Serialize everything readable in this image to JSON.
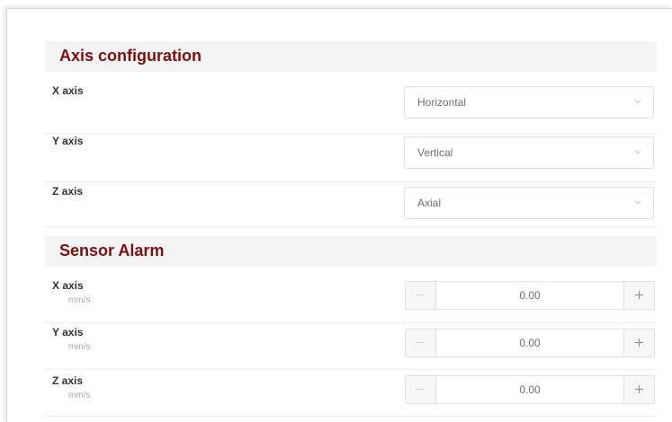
{
  "axis_configuration": {
    "title": "Axis configuration",
    "rows": [
      {
        "label": "X axis",
        "value": "Horizontal"
      },
      {
        "label": "Y axis",
        "value": "Vertical"
      },
      {
        "label": "Z axis",
        "value": "Axial"
      }
    ]
  },
  "sensor_alarm": {
    "title": "Sensor Alarm",
    "rows": [
      {
        "label": "X axis",
        "unit": "mm/s",
        "value": "0.00"
      },
      {
        "label": "Y axis",
        "unit": "mm/s",
        "value": "0.00"
      },
      {
        "label": "Z axis",
        "unit": "mm/s",
        "value": "0.00"
      }
    ]
  },
  "colors": {
    "section_title": "#7c1010",
    "section_header_bg": "#f4f4f4",
    "border": "#e1e1e1"
  },
  "icons": {
    "dropdown": "chevron-down-icon",
    "decrement": "minus-icon",
    "increment": "plus-icon"
  }
}
